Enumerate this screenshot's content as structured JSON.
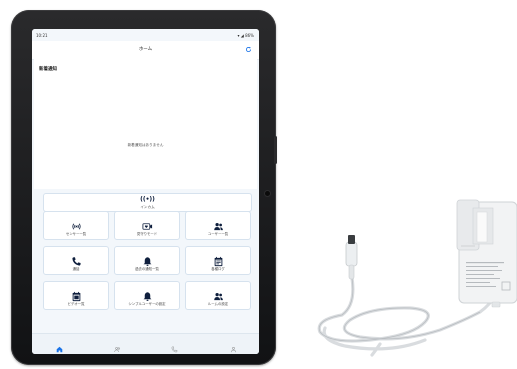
{
  "status_bar": {
    "time": "10:21",
    "right_text": "▾ ◢ 86%"
  },
  "header": {
    "title": "ホーム"
  },
  "notice": {
    "heading": "新着通知",
    "empty_text": "新着通知はありません"
  },
  "intercom": {
    "icon": "((•))",
    "label": "インカム"
  },
  "tiles": [
    {
      "label": "センサー一覧",
      "icon": "sensor-icon"
    },
    {
      "label": "見守りモード",
      "icon": "video-heart-icon"
    },
    {
      "label": "ユーザー一覧",
      "icon": "users-icon"
    },
    {
      "label": "通話",
      "icon": "phone-icon"
    },
    {
      "label": "過去の通知一覧",
      "icon": "bell-icon"
    },
    {
      "label": "各種ログ",
      "icon": "calendar-log-icon"
    },
    {
      "label": "ビデオ一覧",
      "icon": "calendar-video-icon"
    },
    {
      "label": "シンプルユーザーの設定",
      "icon": "bell-simple-icon"
    },
    {
      "label": "ルームの設定",
      "icon": "room-users-icon"
    }
  ],
  "bottom_nav": [
    {
      "label": "",
      "icon": "home-icon"
    },
    {
      "label": "",
      "icon": "users-icon"
    },
    {
      "label": "",
      "icon": "phone-icon"
    },
    {
      "label": "",
      "icon": "user-icon"
    }
  ],
  "colors": {
    "accent": "#1a73e8",
    "icon_dark": "#0f1f3d",
    "screen_bg": "#f3f7fb",
    "tile_border": "#d6e2ee"
  }
}
